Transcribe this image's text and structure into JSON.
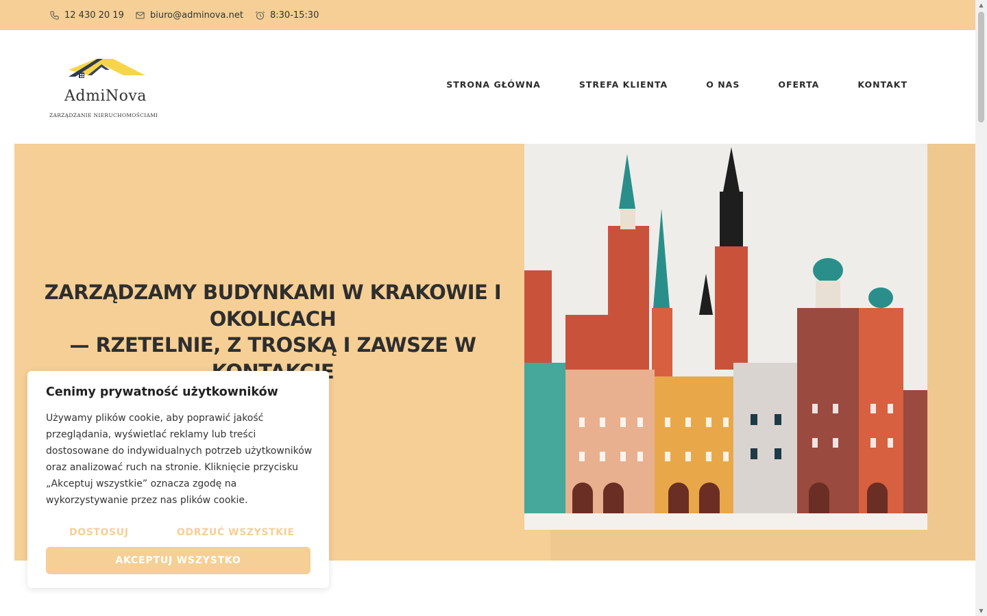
{
  "topbar": {
    "phone": "12 430 20 19",
    "email": "biuro@adminova.net",
    "hours": "8:30-15:30",
    "icons": [
      "phone-icon",
      "mail-icon",
      "clock-icon"
    ]
  },
  "logo": {
    "name": "AdmiNova",
    "tagline": "ZARZĄDZANIE NIERUCHOMOŚCIAMI"
  },
  "nav": {
    "items": [
      "STRONA GŁÓWNA",
      "STREFA KLIENTA",
      "O NAS",
      "OFERTA",
      "KONTAKT"
    ]
  },
  "hero": {
    "title_line1": "ZARZĄDZAMY BUDYNKAMI W KRAKOWIE I",
    "title_line2": "OKOLICACH",
    "title_line3": "— RZETELNIE, Z TROSKĄ I ZAWSZE W",
    "title_line4": "KONTAKCIE"
  },
  "cookie": {
    "title": "Cenimy prywatność użytkowników",
    "text": "Używamy plików cookie, aby poprawić jakość przeglądania, wyświetlać reklamy lub treści dostosowane do indywidualnych potrzeb użytkowników oraz analizować ruch na stronie. Kliknięcie przycisku „Akceptuj wszystkie” oznacza zgodę na wykorzystywanie przez nas plików cookie.",
    "customize": "DOSTOSUJ",
    "reject": "ODRZUĆ WSZYSTKIE",
    "accept": "AKCEPTUJ WSZYSTKO"
  },
  "colors": {
    "accent": "#f5cf95",
    "text": "#2b2b2b"
  }
}
